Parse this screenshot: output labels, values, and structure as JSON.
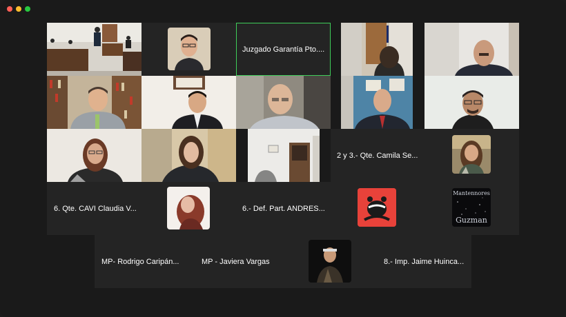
{
  "window": {
    "traffic_lights": [
      "close",
      "minimize",
      "maximize"
    ]
  },
  "colors": {
    "active_speaker": "#3fcf5a",
    "tile_bg": "#242424",
    "window_bg": "#1a1a1a"
  },
  "participants": {
    "juzgado": "Juzgado Garantía Pto....",
    "camila": "2 y 3.- Qte. Camila Se...",
    "cavi": "6. Qte. CAVI Claudia V...",
    "andres": "6.- Def. Part. ANDRES...",
    "rodrigo": "MP- Rodrigo Caripán...",
    "javiera": "MP - Javiera Vargas",
    "jaime": "8.- Imp. Jaime Huinca..."
  },
  "avatar_texts": {
    "guzman_top": "Mantennores",
    "guzman_bottom": "Guzman"
  },
  "icons": {
    "andres_avatar": "deadpool-hug-icon"
  }
}
